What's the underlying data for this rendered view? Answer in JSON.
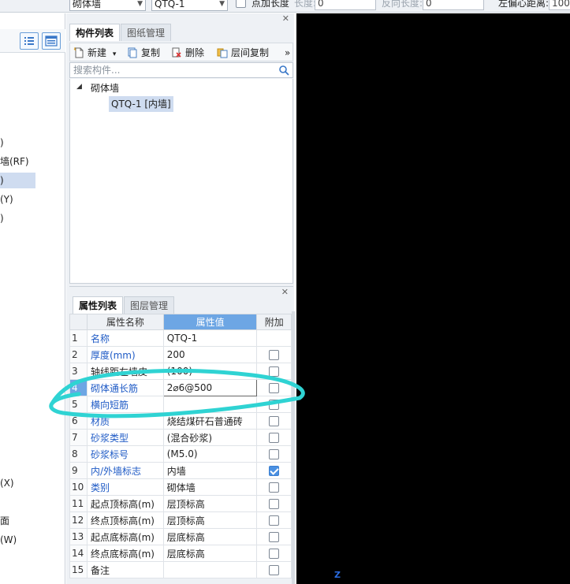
{
  "topbar": {
    "type_select": "砌体墙",
    "name_select": "QTQ-1",
    "add_length_label": "点加长度",
    "length_label": "长度:",
    "length_value": "0",
    "reverse_length_label": "反向长度:",
    "reverse_length_value": "0",
    "offset_label": "左偏心距离:",
    "offset_value": "100"
  },
  "left_pane": {
    "items": [
      {
        "label": ")",
        "selected": false
      },
      {
        "label": "墙(RF)",
        "selected": false
      },
      {
        "label": ")",
        "selected": true
      },
      {
        "label": "(Y)",
        "selected": false
      },
      {
        "label": ")",
        "selected": false
      },
      {
        "label": "(X)",
        "selected": false
      },
      {
        "label": "面",
        "selected": false
      },
      {
        "label": "(W)",
        "selected": false
      }
    ]
  },
  "component_panel": {
    "tabs": [
      "构件列表",
      "图纸管理"
    ],
    "toolbar": {
      "new_label": "新建",
      "copy_label": "复制",
      "delete_label": "删除",
      "floor_copy_label": "层间复制",
      "more_label": "»"
    },
    "search_placeholder": "搜索构件...",
    "tree": {
      "group_label": "砌体墙",
      "child_label": "QTQ-1 [内墙]"
    }
  },
  "property_panel": {
    "tabs": [
      "属性列表",
      "图层管理"
    ],
    "headers": {
      "name": "属性名称",
      "value": "属性值",
      "add": "附加"
    },
    "rows": [
      {
        "num": "1",
        "name": "名称",
        "value": "QTQ-1",
        "blue": true,
        "checkbox": "none"
      },
      {
        "num": "2",
        "name": "厚度(mm)",
        "value": "200",
        "blue": true,
        "checkbox": "off"
      },
      {
        "num": "3",
        "name": "轴线距左墙皮",
        "value": "(100)",
        "blue": false,
        "checkbox": "off"
      },
      {
        "num": "4",
        "name": "砌体通长筋",
        "value": "2⌀6@500",
        "blue": true,
        "checkbox": "off"
      },
      {
        "num": "5",
        "name": "横向短筋",
        "value": "",
        "blue": true,
        "checkbox": "off"
      },
      {
        "num": "6",
        "name": "材质",
        "value": "烧结煤矸石普通砖",
        "blue": true,
        "checkbox": "off"
      },
      {
        "num": "7",
        "name": "砂浆类型",
        "value": "(混合砂浆)",
        "blue": true,
        "checkbox": "off"
      },
      {
        "num": "8",
        "name": "砂浆标号",
        "value": "(M5.0)",
        "blue": true,
        "checkbox": "off"
      },
      {
        "num": "9",
        "name": "内/外墙标志",
        "value": "内墙",
        "blue": true,
        "checkbox": "on"
      },
      {
        "num": "10",
        "name": "类别",
        "value": "砌体墙",
        "blue": true,
        "checkbox": "off"
      },
      {
        "num": "11",
        "name": "起点顶标高(m)",
        "value": "层顶标高",
        "blue": false,
        "checkbox": "off"
      },
      {
        "num": "12",
        "name": "终点顶标高(m)",
        "value": "层顶标高",
        "blue": false,
        "checkbox": "off"
      },
      {
        "num": "13",
        "name": "起点底标高(m)",
        "value": "层底标高",
        "blue": false,
        "checkbox": "off"
      },
      {
        "num": "14",
        "name": "终点底标高(m)",
        "value": "层底标高",
        "blue": false,
        "checkbox": "off"
      },
      {
        "num": "15",
        "name": "备注",
        "value": "",
        "blue": false,
        "checkbox": "off"
      }
    ]
  },
  "canvas": {
    "axis_label": "Z"
  },
  "colors": {
    "header_highlight": "#6da6e4",
    "blue_text": "#1f5bc6",
    "annotation": "#2fd3d3",
    "canvas_bg": "#000000"
  }
}
